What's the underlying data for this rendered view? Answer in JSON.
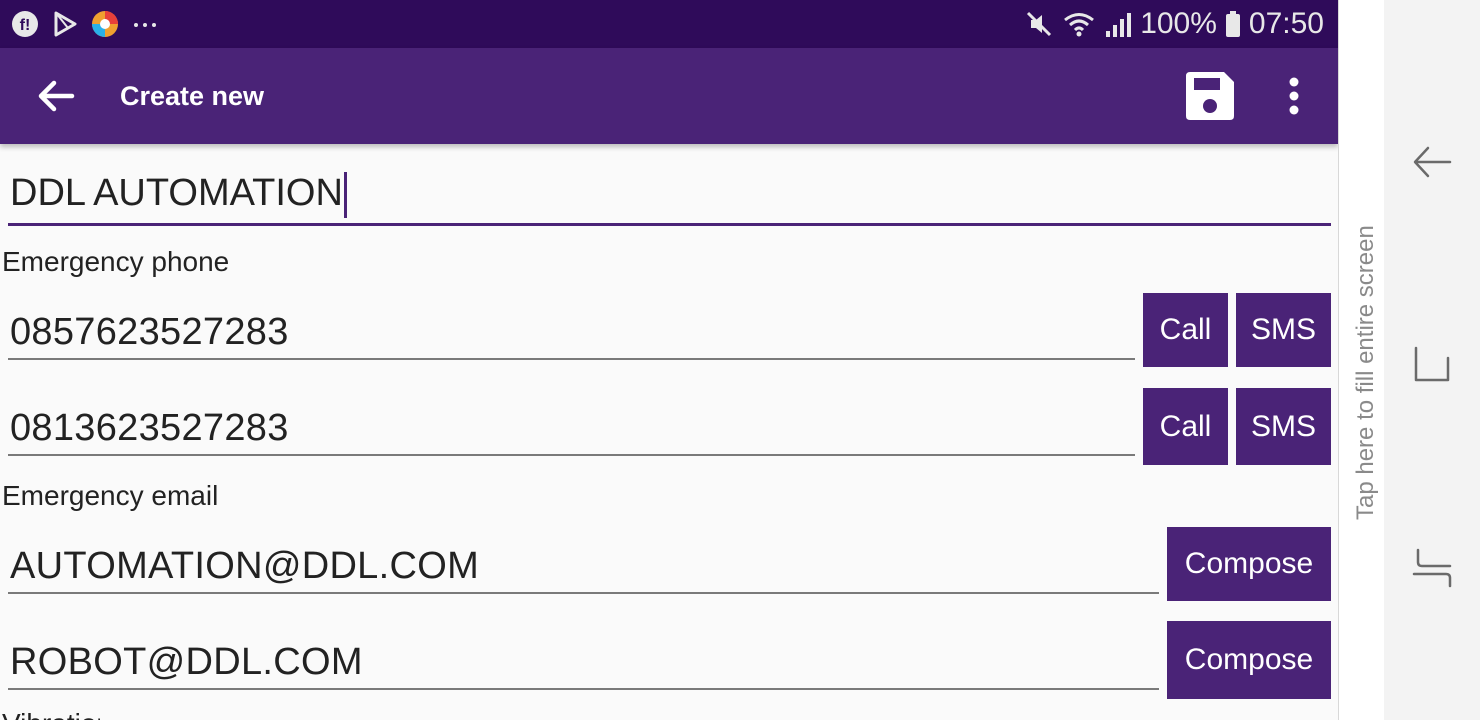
{
  "status_bar": {
    "icons_left": [
      "app-notification-icon",
      "play-store-icon",
      "browser-icon",
      "more-notifications-icon"
    ],
    "battery": "100%",
    "time": "07:50",
    "icons_right": [
      "mute-icon",
      "wifi-icon",
      "signal-icon",
      "battery-icon"
    ]
  },
  "app_bar": {
    "title": "Create new",
    "back_icon": "back-arrow-icon",
    "save_icon": "save-icon",
    "menu_icon": "more-vert-icon"
  },
  "form": {
    "name_value": "DDL AUTOMATION",
    "phone_section_label": "Emergency phone",
    "phones": [
      {
        "value": "0857623527283",
        "call_label": "Call",
        "sms_label": "SMS"
      },
      {
        "value": "0813623527283",
        "call_label": "Call",
        "sms_label": "SMS"
      }
    ],
    "email_section_label": "Emergency email",
    "emails": [
      {
        "value": "AUTOMATION@DDL.COM",
        "compose_label": "Compose"
      },
      {
        "value": "ROBOT@DDL.COM",
        "compose_label": "Compose"
      }
    ],
    "next_section_label_partial": "Vibration"
  },
  "side_strip": {
    "text": "Tap here to fill entire screen"
  },
  "nav_bar": {
    "buttons": [
      "back-nav-icon",
      "home-nav-icon",
      "recents-nav-icon"
    ]
  },
  "colors": {
    "status_bar": "#2f0b5a",
    "app_bar": "#4a2377",
    "accent": "#4a2377",
    "button": "#4a2377"
  }
}
